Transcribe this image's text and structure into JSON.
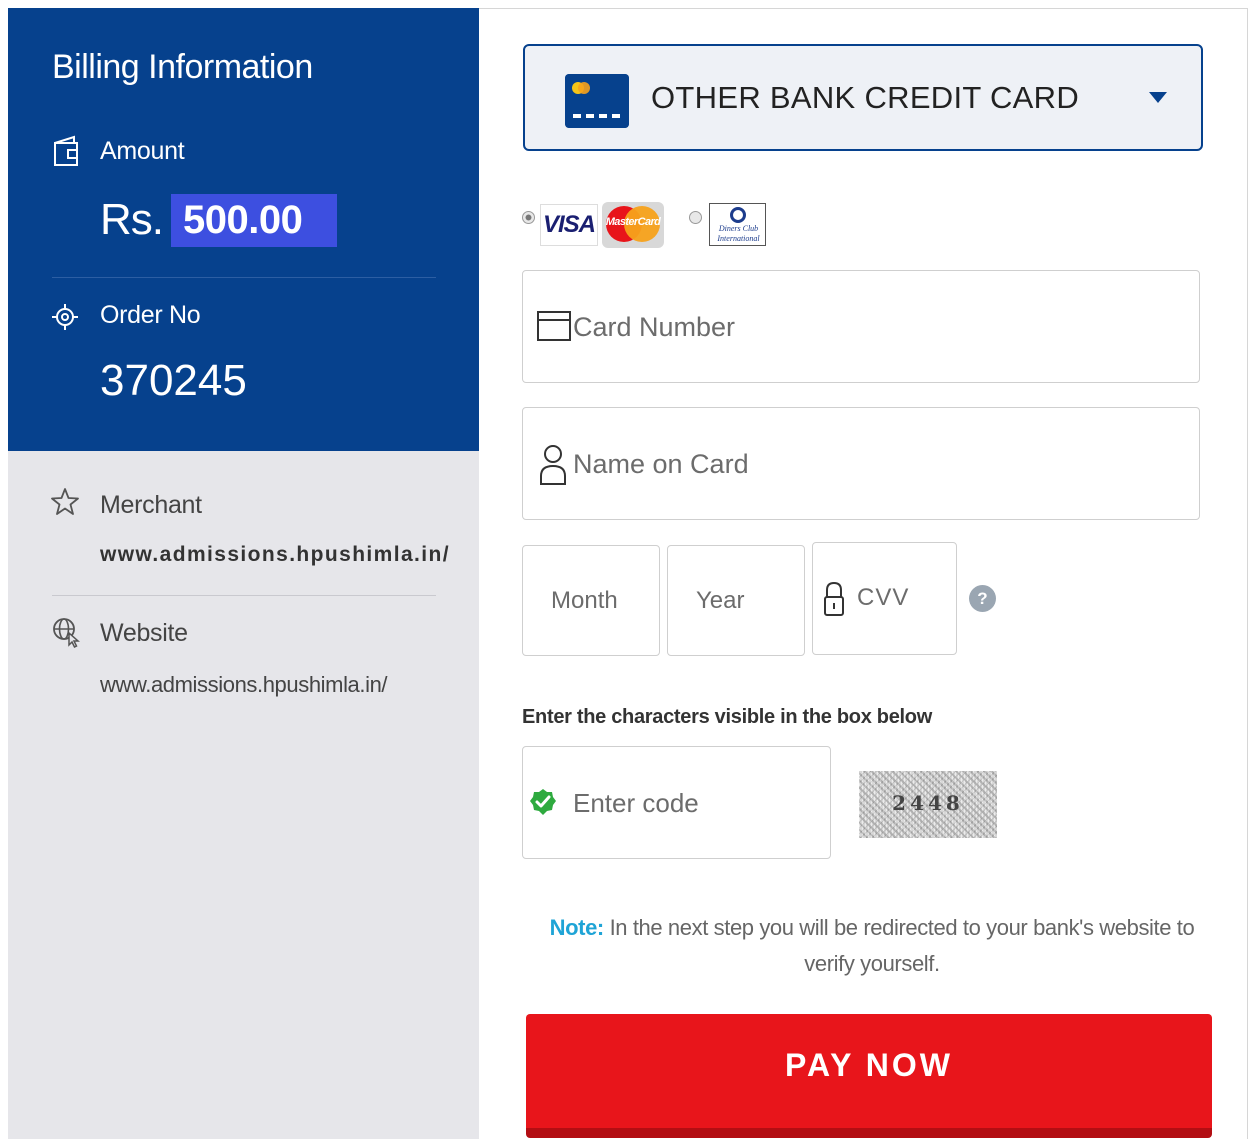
{
  "billing": {
    "title": "Billing Information",
    "amount_label": "Amount",
    "currency": "Rs.",
    "amount": "500.00",
    "order_label": "Order No",
    "order_no": "370245"
  },
  "merchant": {
    "label": "Merchant",
    "value": "www.admissions.hpushimla.in/"
  },
  "website": {
    "label": "Website",
    "value": "www.admissions.hpushimla.in/"
  },
  "payment_method": {
    "selected": "OTHER BANK CREDIT CARD",
    "icon": "credit-card-icon"
  },
  "card_networks": {
    "visa": "VISA",
    "mastercard": "MasterCard",
    "diners_line1": "Diners Club",
    "diners_line2": "International"
  },
  "form": {
    "card_number_placeholder": "Card Number",
    "name_placeholder": "Name on Card",
    "month_placeholder": "Month",
    "year_placeholder": "Year",
    "cvv_placeholder": "CVV",
    "help": "?"
  },
  "captcha": {
    "label": "Enter the characters visible in the box below",
    "placeholder": "Enter code",
    "code": "2448"
  },
  "note": {
    "label": "Note:",
    "text": "In the next step you will be redirected to your bank's website to verify yourself."
  },
  "pay_button": "PAY NOW",
  "colors": {
    "brand_blue": "#06418d",
    "amount_highlight": "#3d4fe0",
    "pay_red": "#e8151b",
    "note_blue": "#1fa4d6"
  }
}
